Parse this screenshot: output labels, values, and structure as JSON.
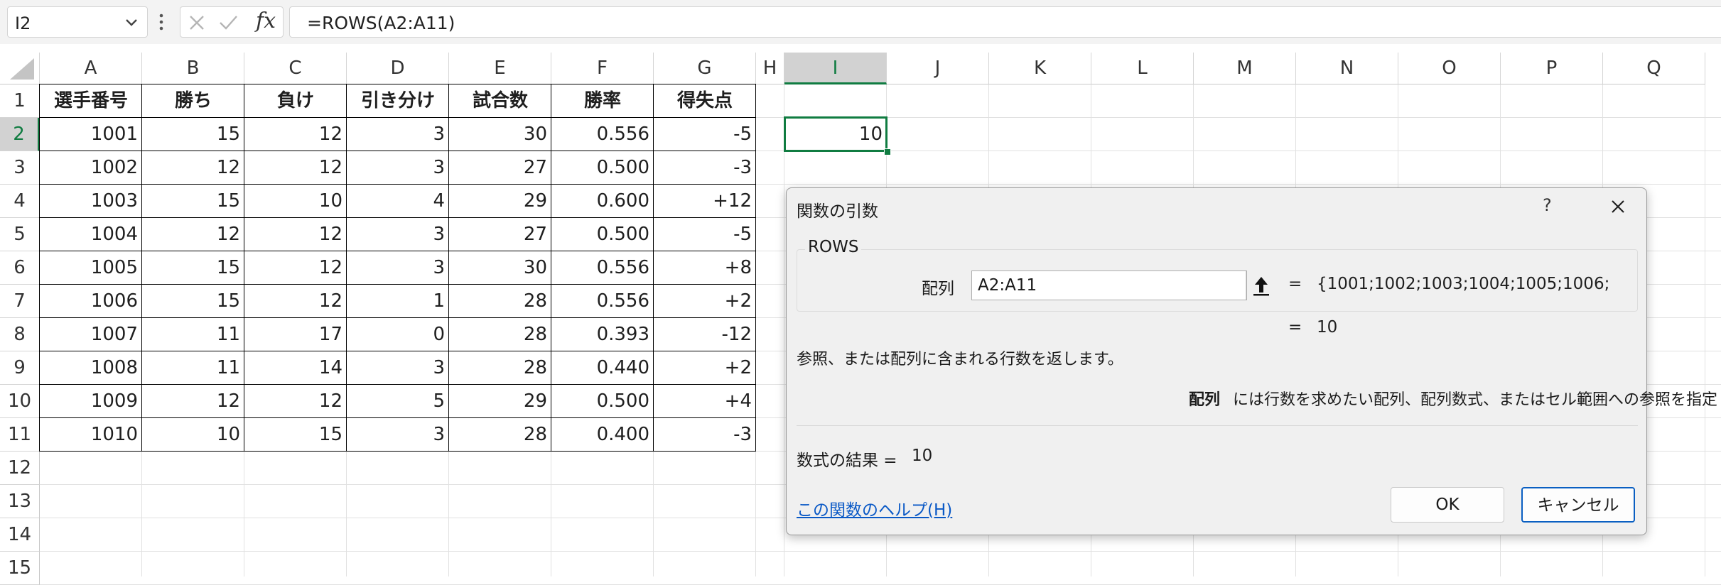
{
  "formula_bar": {
    "name_box": "I2",
    "fx_label": "fx",
    "formula": "=ROWS(A2:A11)"
  },
  "columns": [
    "A",
    "B",
    "C",
    "D",
    "E",
    "F",
    "G",
    "H",
    "I",
    "J",
    "K",
    "L",
    "M",
    "N",
    "O",
    "P",
    "Q"
  ],
  "rows": [
    "1",
    "2",
    "3",
    "4",
    "5",
    "6",
    "7",
    "8",
    "9",
    "10",
    "11",
    "12",
    "13",
    "14",
    "15"
  ],
  "table": {
    "headers": [
      "選手番号",
      "勝ち",
      "負け",
      "引き分け",
      "試合数",
      "勝率",
      "得失点"
    ],
    "rows": [
      [
        "1001",
        "15",
        "12",
        "3",
        "30",
        "0.556",
        "-5"
      ],
      [
        "1002",
        "12",
        "12",
        "3",
        "27",
        "0.500",
        "-3"
      ],
      [
        "1003",
        "15",
        "10",
        "4",
        "29",
        "0.600",
        "+12"
      ],
      [
        "1004",
        "12",
        "12",
        "3",
        "27",
        "0.500",
        "-5"
      ],
      [
        "1005",
        "15",
        "12",
        "3",
        "30",
        "0.556",
        "+8"
      ],
      [
        "1006",
        "15",
        "12",
        "1",
        "28",
        "0.556",
        "+2"
      ],
      [
        "1007",
        "11",
        "17",
        "0",
        "28",
        "0.393",
        "-12"
      ],
      [
        "1008",
        "11",
        "14",
        "3",
        "28",
        "0.440",
        "+2"
      ],
      [
        "1009",
        "12",
        "12",
        "5",
        "29",
        "0.500",
        "+4"
      ],
      [
        "1010",
        "10",
        "15",
        "3",
        "28",
        "0.400",
        "-3"
      ]
    ]
  },
  "active_cell": {
    "ref": "I2",
    "value": "10"
  },
  "dialog": {
    "title": "関数の引数",
    "help_glyph": "?",
    "function_name": "ROWS",
    "arg_label": "配列",
    "arg_value": "A2:A11",
    "equals": "=",
    "arg_evaluated": "{1001;1002;1003;1004;1005;1006;",
    "arg_result": "10",
    "description": "参照、または配列に含まれる行数を返します。",
    "arg_help_label": "配列",
    "arg_help_text": "には行数を求めたい配列、配列数式、またはセル範囲への参照を指定します。",
    "result_label": "数式の結果 =",
    "result_value": "10",
    "help_link": "この関数のヘルプ(H)",
    "ok_label": "OK",
    "cancel_label": "キャンセル"
  },
  "colors": {
    "accent_green": "#107c41",
    "link_blue": "#0a59c6",
    "focus_blue": "#0a5fc2"
  }
}
